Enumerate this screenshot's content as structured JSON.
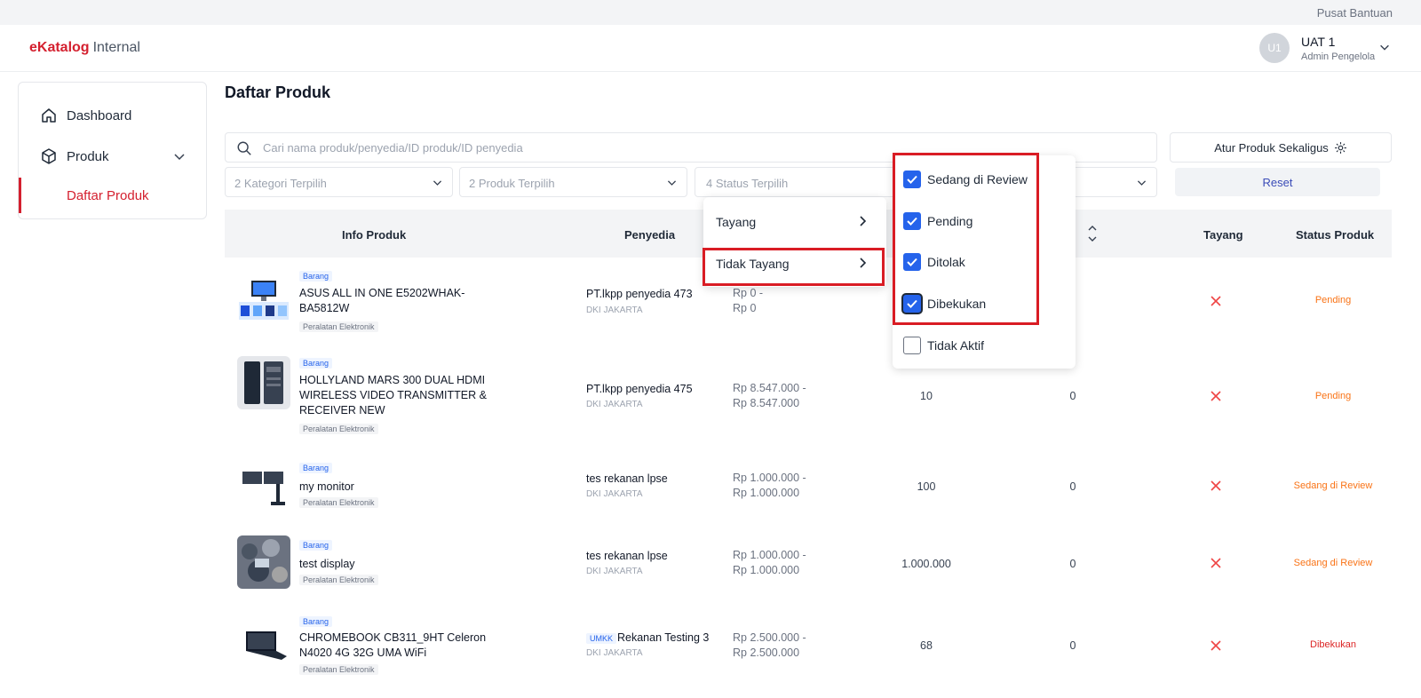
{
  "topbar": {
    "help": "Pusat Bantuan"
  },
  "brand": {
    "mark": "eKatalog",
    "sub": "Internal"
  },
  "user": {
    "initials": "U1",
    "name": "UAT 1",
    "role": "Admin Pengelola"
  },
  "sidebar": {
    "dashboard": "Dashboard",
    "produk": "Produk",
    "daftar_produk": "Daftar Produk"
  },
  "page": {
    "title": "Daftar Produk"
  },
  "search": {
    "placeholder": "Cari nama produk/penyedia/ID produk/ID penyedia"
  },
  "actions": {
    "atur": "Atur Produk Sekaligus",
    "reset": "Reset"
  },
  "filters": {
    "kategori": "2 Kategori Terpilih",
    "produk": "2 Produk Terpilih",
    "status": "4 Status Terpilih"
  },
  "table": {
    "headers": {
      "info": "Info Produk",
      "penyedia": "Penyedia",
      "tayang": "Tayang",
      "status": "Status Produk"
    },
    "rows": [
      {
        "type": "Barang",
        "name": "ASUS ALL IN ONE E5202WHAK-BA5812W",
        "category": "Peralatan Elektronik",
        "vendor": "PT.lkpp penyedia 473",
        "location": "DKI JAKARTA",
        "price": "Rp 0 -\nRp 0",
        "stock": "",
        "sold": "",
        "status": "Pending"
      },
      {
        "type": "Barang",
        "name": "HOLLYLAND MARS 300 DUAL HDMI WIRELESS VIDEO TRANSMITTER & RECEIVER NEW",
        "category": "Peralatan Elektronik",
        "vendor": "PT.lkpp penyedia 475",
        "location": "DKI JAKARTA",
        "price": "Rp 8.547.000 -\nRp 8.547.000",
        "stock": "10",
        "sold": "0",
        "status": "Pending"
      },
      {
        "type": "Barang",
        "name": "my monitor",
        "category": "Peralatan Elektronik",
        "vendor": "tes rekanan lpse",
        "location": "DKI JAKARTA",
        "price": "Rp 1.000.000 -\nRp 1.000.000",
        "stock": "100",
        "sold": "0",
        "status": "Sedang di Review"
      },
      {
        "type": "Barang",
        "name": "test display",
        "category": "Peralatan Elektronik",
        "vendor": "tes rekanan lpse",
        "location": "DKI JAKARTA",
        "price": "Rp 1.000.000 -\nRp 1.000.000",
        "stock": "1.000.000",
        "sold": "0",
        "status": "Sedang di Review"
      },
      {
        "type": "Barang",
        "name": "CHROMEBOOK CB311_9HT Celeron N4020 4G 32G UMA WiFi",
        "category": "Peralatan Elektronik",
        "vendor_badge": "UMKK",
        "vendor": "Rekanan Testing 3",
        "location": "DKI JAKARTA",
        "price": "Rp 2.500.000 -\nRp 2.500.000",
        "stock": "68",
        "sold": "0",
        "status": "Dibekukan"
      }
    ]
  },
  "tayang_menu": {
    "items": [
      "Tayang",
      "Tidak Tayang"
    ]
  },
  "status_menu": {
    "options": [
      {
        "label": "Sedang di Review",
        "checked": true
      },
      {
        "label": "Pending",
        "checked": true
      },
      {
        "label": "Ditolak",
        "checked": true
      },
      {
        "label": "Dibekukan",
        "checked": true
      },
      {
        "label": "Tidak Aktif",
        "checked": false
      }
    ]
  },
  "colors": {
    "brand": "#d4202f",
    "accent": "#2563eb",
    "highlight": "#d91c24"
  }
}
